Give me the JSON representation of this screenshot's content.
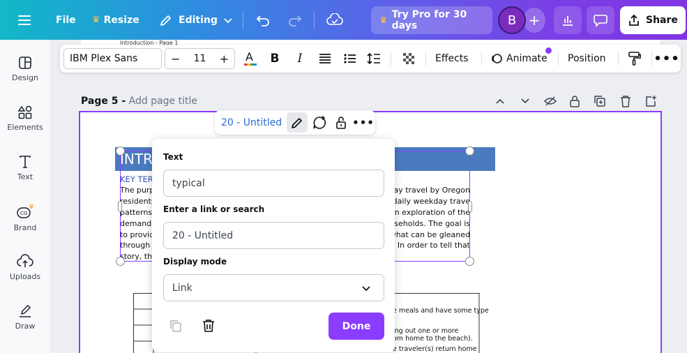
{
  "topbar": {
    "file_label": "File",
    "resize_label": "Resize",
    "editing_label": "Editing",
    "pro_label": "Try Pro for 30 days",
    "avatar_initial": "B",
    "share_label": "Share",
    "gradient_start": "#11b8c8",
    "gradient_end": "#8135e2"
  },
  "sidebar": {
    "items": [
      {
        "label": "Design",
        "icon": "design-icon"
      },
      {
        "label": "Elements",
        "icon": "elements-icon"
      },
      {
        "label": "Text",
        "icon": "text-icon"
      },
      {
        "label": "Brand",
        "icon": "brand-icon"
      },
      {
        "label": "Uploads",
        "icon": "uploads-icon"
      },
      {
        "label": "Draw",
        "icon": "draw-icon"
      }
    ]
  },
  "format_toolbar": {
    "font_family": "IBM Plex Sans",
    "font_size": "11",
    "effects_label": "Effects",
    "animate_label": "Animate",
    "position_label": "Position"
  },
  "previous_page": {
    "caption": "Introduction - Page 1"
  },
  "page": {
    "number_label": "Page 5 -",
    "title_placeholder": "Add page title"
  },
  "document": {
    "header": "INTR",
    "key_terms": "KEY TER",
    "left_lines": [
      "The purp",
      "residents",
      "patterns",
      "demand",
      "to provid",
      "through",
      "story, the"
    ],
    "right_lines": [
      "ay travel by Oregon",
      "daily weekday trave",
      "n exploration of the",
      "useholds. The goal is",
      "what can be gleaned",
      "In order to tell that"
    ],
    "table_lines": [
      "e meals and have some type",
      "ing out one or more",
      "om home to the beach).",
      "e traveler(s) return home"
    ]
  },
  "element_toolbar": {
    "name": "20 - Untitled"
  },
  "link_panel": {
    "text_label": "Text",
    "text_value": "typical",
    "link_label": "Enter a link or search",
    "link_value": "20 - Untitled",
    "display_label": "Display mode",
    "display_value": "Link",
    "done_label": "Done",
    "accent": "#8b3dff"
  }
}
